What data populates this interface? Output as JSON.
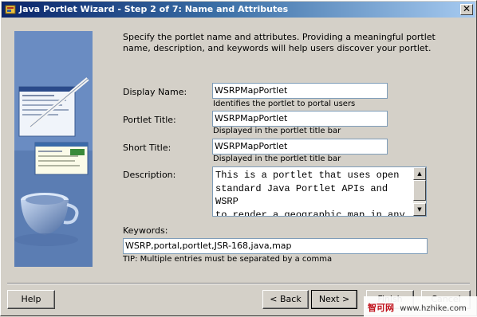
{
  "window": {
    "title": "Java Portlet Wizard - Step 2 of 7: Name and Attributes",
    "close_glyph": "✕"
  },
  "intro": "Specify the portlet name and attributes. Providing a meaningful portlet name, description, and keywords will help users discover your portlet.",
  "fields": {
    "display_name": {
      "label": "Display Name:",
      "value": "WSRPMapPortlet",
      "hint": "Identifies the portlet to portal users"
    },
    "portlet_title": {
      "label": "Portlet Title:",
      "value": "WSRPMapPortlet",
      "hint": "Displayed in the portlet title bar"
    },
    "short_title": {
      "label": "Short Title:",
      "value": "WSRPMapPortlet",
      "hint": "Displayed in the portlet title bar"
    },
    "description": {
      "label": "Description:",
      "value": "This is a portlet that uses open\nstandard Java Portlet APIs and WSRP\nto render a geographic map in any\nWSRP-compliant portal environment."
    },
    "keywords": {
      "label": "Keywords:",
      "value": "WSRP,portal,portlet,JSR-168,java,map",
      "tip": "TIP: Multiple entries must be separated by a comma"
    }
  },
  "buttons": {
    "help": "Help",
    "back": "< Back",
    "next": "Next >",
    "finish": "Finish",
    "cancel": "Cancel"
  },
  "watermark": {
    "brand": "智可网",
    "url": "www.hzhike.com"
  },
  "icons": [
    "wizard-icon",
    "close-icon",
    "scroll-up-icon",
    "scroll-down-icon"
  ]
}
